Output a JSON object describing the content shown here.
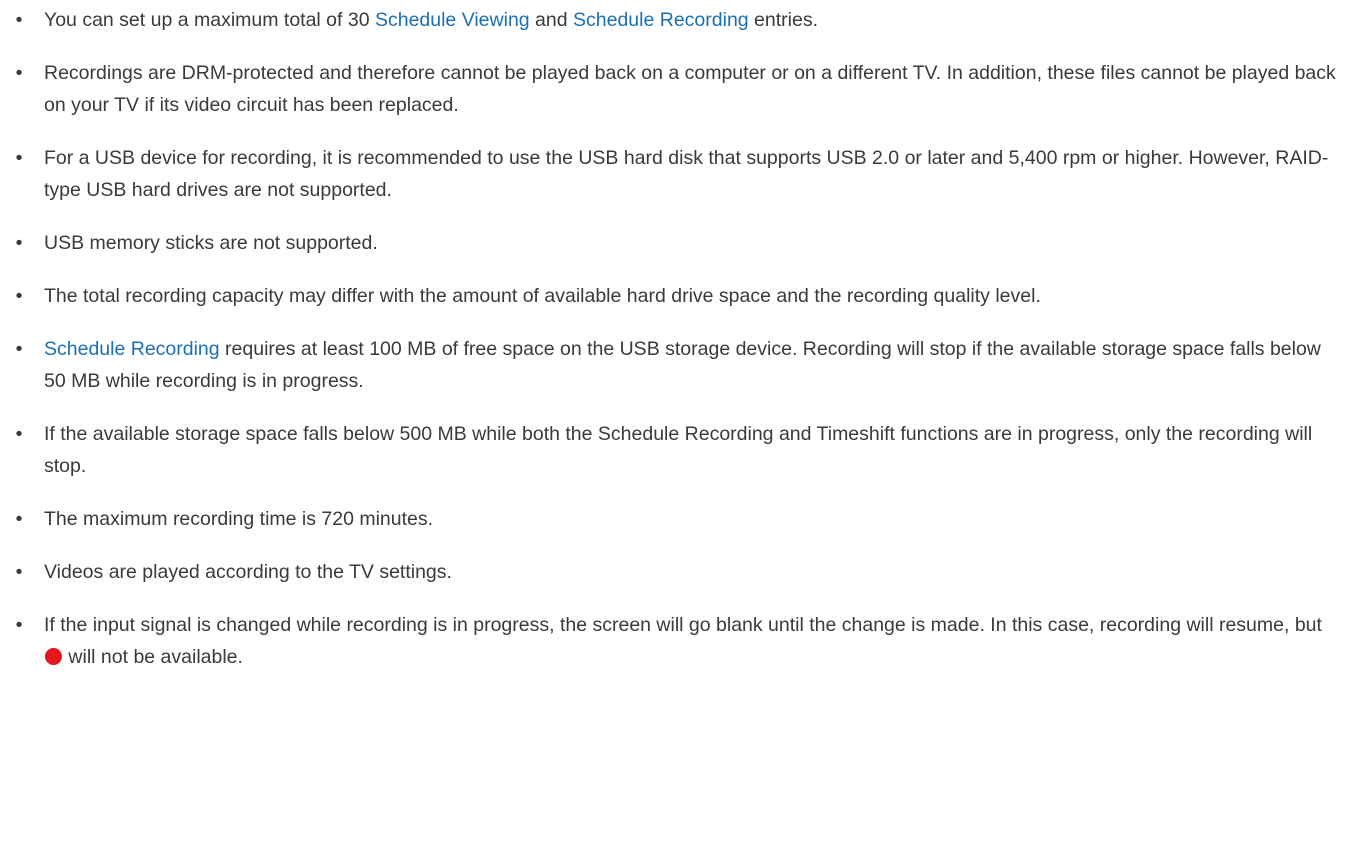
{
  "bullet_char": "•",
  "colors": {
    "text": "#3a3a3a",
    "link": "#1a6fb6",
    "record_icon": "#e8141e"
  },
  "notes": [
    {
      "t0": "You can set up a maximum total of 30 ",
      "link1": "Schedule Viewing",
      "t1": " and ",
      "link2": "Schedule Recording",
      "t2": " entries."
    },
    {
      "text": "Recordings are DRM-protected and therefore cannot be played back on a computer or on a different TV. In addition, these files cannot be played back on your TV if its video circuit has been replaced."
    },
    {
      "text": "For a USB device for recording, it is recommended to use the USB hard disk that supports USB 2.0 or later and 5,400 rpm or higher. However, RAID-type USB hard drives are not supported."
    },
    {
      "text": "USB memory sticks are not supported."
    },
    {
      "text": "The total recording capacity may differ with the amount of available hard drive space and the recording quality level."
    },
    {
      "link1": "Schedule Recording",
      "t0": " requires at least 100 MB of free space on the USB storage device. Recording will stop if the available storage space falls below 50 MB while recording is in progress."
    },
    {
      "text": "If the available storage space falls below 500 MB while both the Schedule Recording and Timeshift functions are in progress, only the recording will stop."
    },
    {
      "text": "The maximum recording time is 720 minutes."
    },
    {
      "text": "Videos are played according to the TV settings."
    },
    {
      "t0": "If the input signal is changed while recording is in progress, the screen will go blank until the change is made. In this case, recording will resume, but ",
      "icon": "record-icon",
      "t1": " will not be available."
    }
  ]
}
